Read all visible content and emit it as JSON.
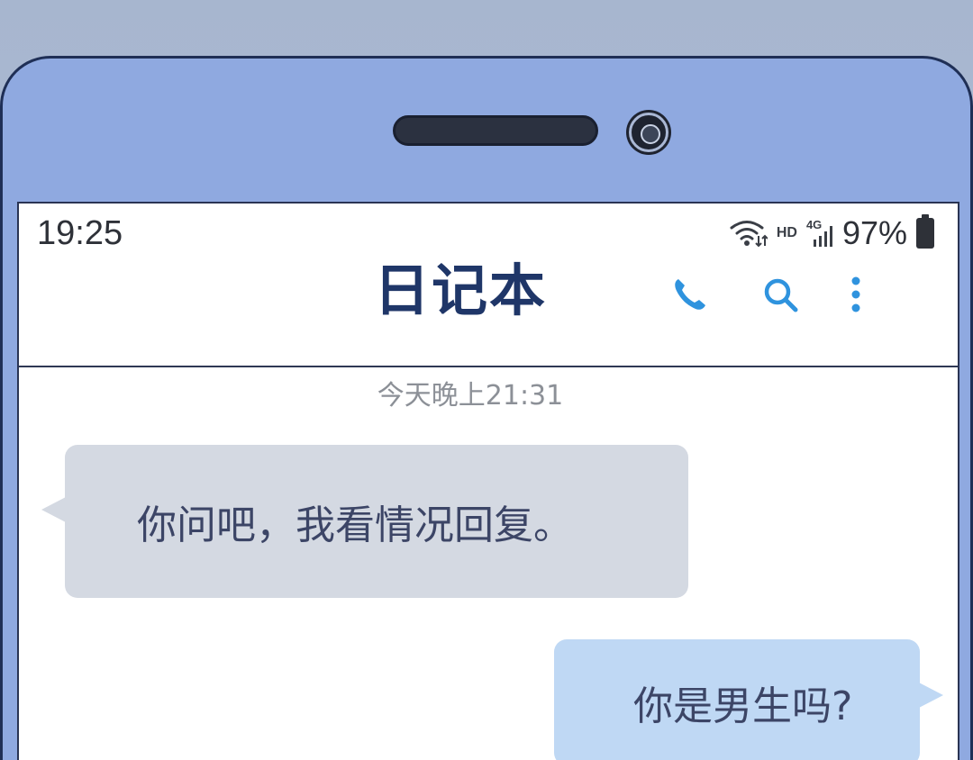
{
  "status_bar": {
    "time": "19:25",
    "hd": "HD",
    "network": "4G",
    "battery_percent": "97%"
  },
  "header": {
    "title": "日记本",
    "icons": [
      "phone-icon",
      "search-icon",
      "more-vertical-icon"
    ]
  },
  "chat": {
    "timestamp": "今天晚上21:31",
    "messages": [
      {
        "direction": "incoming",
        "text": "你问吧，我看情况回复。"
      },
      {
        "direction": "outgoing",
        "text": "你是男生吗?"
      }
    ]
  },
  "colors": {
    "device_body": "#8fa9e0",
    "accent_icon": "#2f93de",
    "title": "#1f3668",
    "incoming_bubble": "#d4d9e2",
    "outgoing_bubble": "#bfd8f4",
    "message_text": "#3c4566"
  }
}
